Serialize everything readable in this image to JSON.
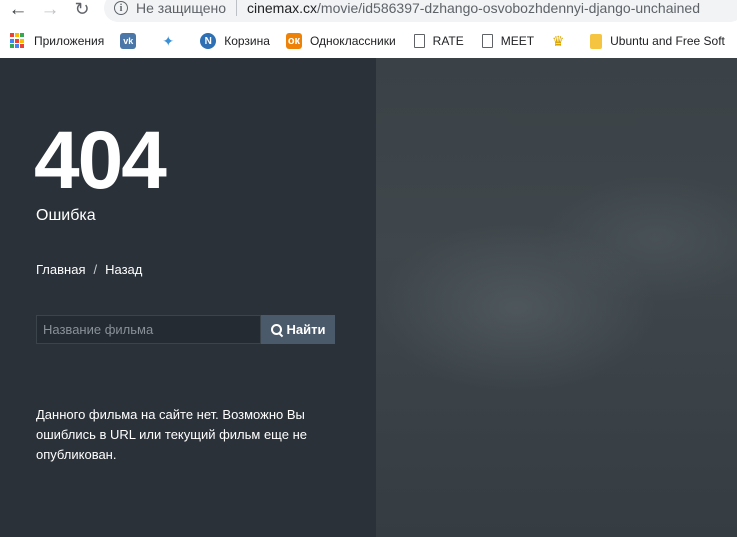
{
  "browser": {
    "security_label": "Не защищено",
    "url_host": "cinemax.cx",
    "url_path": "/movie/id586397-dzhango-osvobozhdennyi-django-unchained",
    "bookmarks": [
      {
        "label": "Приложения",
        "icon": "apps-grid-icon"
      },
      {
        "label": "",
        "icon": "vk-icon"
      },
      {
        "label": "",
        "icon": "bird-icon"
      },
      {
        "label": "Корзина",
        "icon": "n-logo-icon"
      },
      {
        "label": "Одноклассники",
        "icon": "ok-icon"
      },
      {
        "label": "RATE",
        "icon": "page-icon"
      },
      {
        "label": "MEET",
        "icon": "page-icon"
      },
      {
        "label": "",
        "icon": "crown-icon"
      },
      {
        "label": "Ubuntu and Free Soft",
        "icon": "folder-icon"
      },
      {
        "label": "",
        "icon": "dotted-grid-icon"
      }
    ]
  },
  "page": {
    "error_code": "404",
    "error_label": "Ошибка",
    "breadcrumb": {
      "home": "Главная",
      "divider": "/",
      "back": "Назад"
    },
    "search": {
      "placeholder": "Название фильма",
      "button_label": "Найти"
    },
    "message": "Данного фильма на сайте нет. Возможно Вы ошиблись в URL или текущий фильм еще не опубликован."
  },
  "colors": {
    "left_panel": "#2a3139",
    "search_button": "#4b5a6a"
  }
}
